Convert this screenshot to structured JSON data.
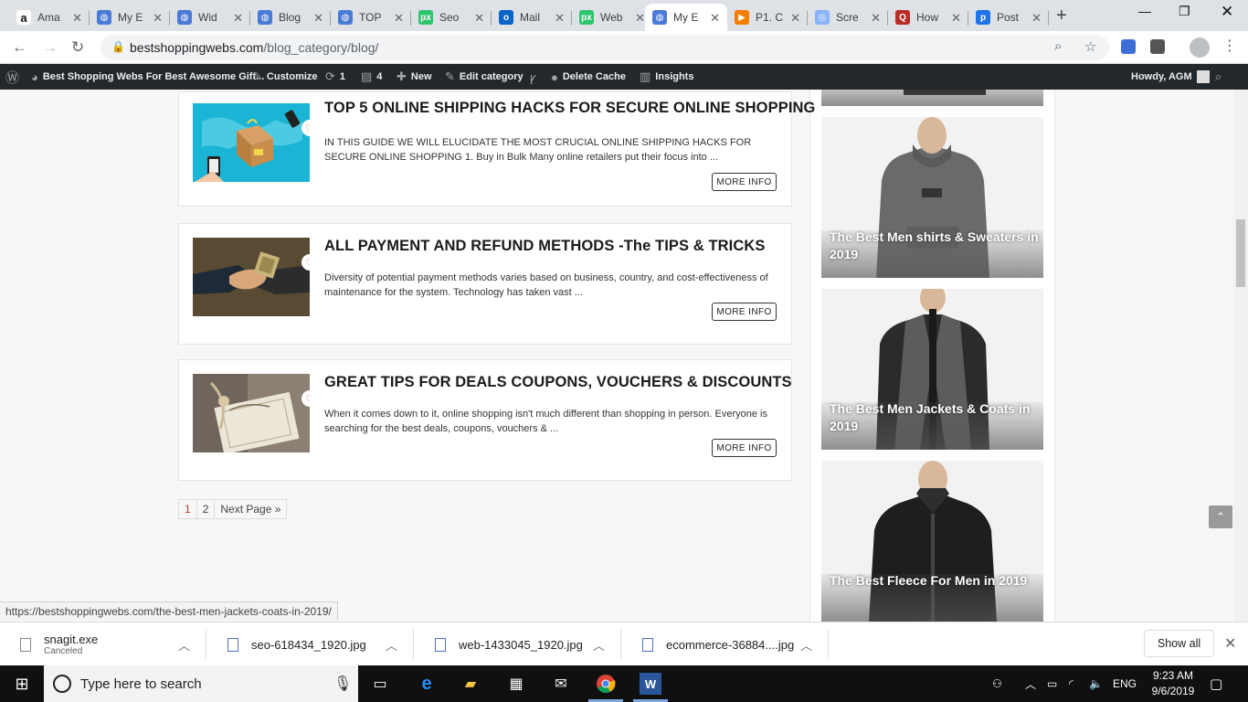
{
  "browser": {
    "tabs": [
      {
        "title": "Ama",
        "icon": "amazon-icon",
        "color": "#ffffff",
        "glyph": "a"
      },
      {
        "title": "My E",
        "icon": "globe-icon",
        "color": "#4a7bd6",
        "glyph": "◍"
      },
      {
        "title": "Wid",
        "icon": "globe-icon",
        "color": "#4a7bd6",
        "glyph": "◍"
      },
      {
        "title": "Blog",
        "icon": "globe-icon",
        "color": "#4a7bd6",
        "glyph": "◍"
      },
      {
        "title": "TOP",
        "icon": "globe-icon",
        "color": "#4a7bd6",
        "glyph": "◍"
      },
      {
        "title": "Seo",
        "icon": "pixabay-icon",
        "color": "#2ec66d",
        "glyph": "px"
      },
      {
        "title": "Mail",
        "icon": "outlook-icon",
        "color": "#0a64c8",
        "glyph": "o"
      },
      {
        "title": "Web",
        "icon": "pixabay-icon",
        "color": "#2ec66d",
        "glyph": "px"
      },
      {
        "title": "My E",
        "icon": "globe-icon",
        "color": "#4a7bd6",
        "glyph": "◍"
      },
      {
        "title": "P1. C",
        "icon": "play-icon",
        "color": "#f57c00",
        "glyph": "▶"
      },
      {
        "title": "Scre",
        "icon": "screencast-icon",
        "color": "#8ab4f8",
        "glyph": "◎"
      },
      {
        "title": "How",
        "icon": "quora-icon",
        "color": "#b92b27",
        "glyph": "Q"
      },
      {
        "title": "Post",
        "icon": "postimg-icon",
        "color": "#1e73e8",
        "glyph": "p"
      }
    ],
    "url_host": "bestshoppingwebs.com",
    "url_path": "/blog_category/blog/"
  },
  "adminbar": {
    "site": "Best Shopping Webs For Best Awesome Gift...",
    "customize": "Customize",
    "updates": "1",
    "comments": "4",
    "new": "New",
    "edit": "Edit category",
    "cache": "Delete Cache",
    "insights": "Insights",
    "howdy": "Howdy, AGM"
  },
  "posts": [
    {
      "title": "TOP 5 ONLINE SHIPPING HACKS FOR SECURE ONLINE SHOPPING",
      "excerpt": "IN THIS GUIDE WE WILL ELUCIDATE THE MOST CRUCIAL ONLINE SHIPPING HACKS FOR SECURE ONLINE SHOPPING 1. Buy in Bulk Many online retailers put their focus into ...",
      "more": "MORE INFO"
    },
    {
      "title": "ALL PAYMENT AND REFUND METHODS -The TIPS & TRICKS",
      "excerpt": "Diversity of potential payment methods varies based on business, country, and cost-effectiveness of maintenance for the system. Technology has taken vast ...",
      "more": "MORE INFO"
    },
    {
      "title": "GREAT TIPS FOR DEALS COUPONS, VOUCHERS & DISCOUNTS",
      "excerpt": "When it comes down to it, online shopping isn't much different than shopping in person. Everyone is searching for the best deals, coupons, vouchers & ...",
      "more": "MORE INFO"
    }
  ],
  "pagination": {
    "page1": "1",
    "page2": "2",
    "next": "Next Page »"
  },
  "sidebar": [
    {
      "label": "The Best Men shirts & Sweaters in 2019"
    },
    {
      "label": "The Best Men Jackets & Coats in 2019"
    },
    {
      "label": "The Best Fleece For Men in 2019"
    }
  ],
  "status_url": "https://bestshoppingwebs.com/the-best-men-jackets-coats-in-2019/",
  "downloads": [
    {
      "name": "snagit.exe",
      "sub": "Canceled"
    },
    {
      "name": "seo-618434_1920.jpg",
      "sub": ""
    },
    {
      "name": "web-1433045_1920.jpg",
      "sub": ""
    },
    {
      "name": "ecommerce-36884....jpg",
      "sub": ""
    }
  ],
  "show_all": "Show all",
  "taskbar": {
    "search_placeholder": "Type here to search",
    "lang": "ENG",
    "time": "9:23 AM",
    "date": "9/6/2019"
  }
}
